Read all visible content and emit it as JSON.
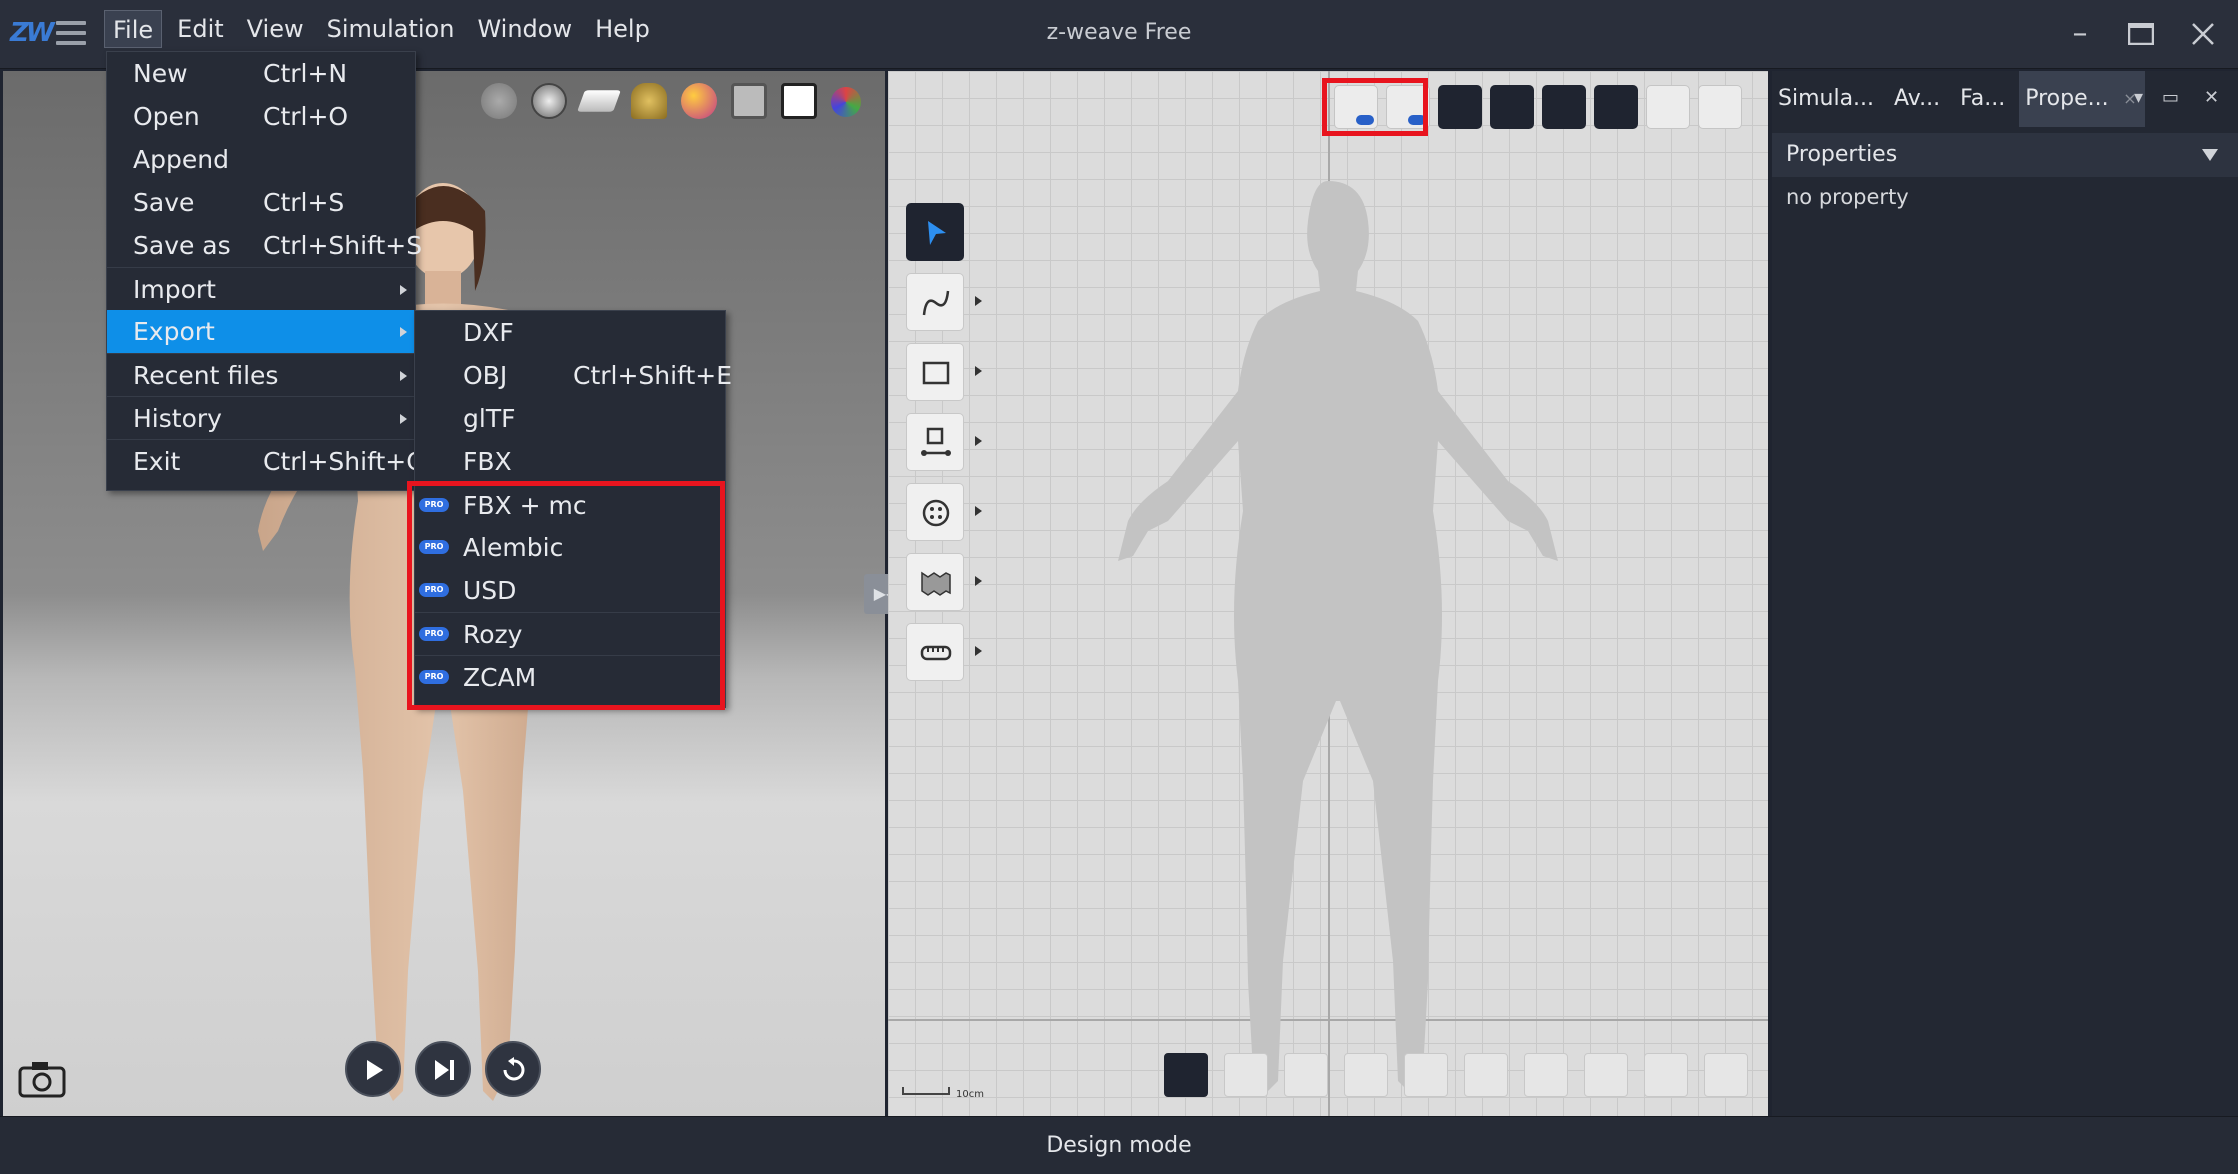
{
  "app": {
    "logo": "ZW",
    "title": "z-weave Free",
    "menubar": [
      "File",
      "Edit",
      "View",
      "Simulation",
      "Window",
      "Help"
    ],
    "window_controls": [
      "minimize-icon",
      "maximize-icon",
      "close-icon"
    ]
  },
  "file_menu": [
    {
      "label": "New",
      "shortcut": "Ctrl+N"
    },
    {
      "label": "Open",
      "shortcut": "Ctrl+O"
    },
    {
      "label": "Append",
      "shortcut": ""
    },
    {
      "label": "Save",
      "shortcut": "Ctrl+S"
    },
    {
      "label": "Save as",
      "shortcut": "Ctrl+Shift+S"
    },
    {
      "label": "Import",
      "shortcut": "",
      "submenu": true
    },
    {
      "label": "Export",
      "shortcut": "",
      "submenu": true,
      "highlighted": true
    },
    {
      "label": "Recent files",
      "shortcut": "",
      "submenu": true
    },
    {
      "label": "History",
      "shortcut": "",
      "submenu": true
    },
    {
      "label": "Exit",
      "shortcut": "Ctrl+Shift+C"
    }
  ],
  "export_menu": [
    {
      "label": "DXF",
      "shortcut": "",
      "pro": false
    },
    {
      "label": "OBJ",
      "shortcut": "Ctrl+Shift+E",
      "pro": false
    },
    {
      "label": "glTF",
      "shortcut": "",
      "pro": false
    },
    {
      "label": "FBX",
      "shortcut": "",
      "pro": false
    },
    {
      "label": "FBX + mc",
      "shortcut": "",
      "pro": true
    },
    {
      "label": "Alembic",
      "shortcut": "",
      "pro": true
    },
    {
      "label": "USD",
      "shortcut": "",
      "pro": true
    },
    {
      "label": "Rozy",
      "shortcut": "",
      "pro": true
    },
    {
      "label": "ZCAM",
      "shortcut": "",
      "pro": true
    }
  ],
  "pro_badge": "PRO",
  "viewport3d": {
    "top_icons": [
      "avatar-mesh-icon",
      "fabric-ball-icon",
      "layer-icon",
      "pose-icon",
      "material-sphere-icon",
      "transparency-icon",
      "sewing-machine-icon",
      "gizmo-icon"
    ],
    "playback": [
      "play-icon",
      "step-forward-icon",
      "reset-icon"
    ]
  },
  "view2d": {
    "top_tools": [
      "avatar-pro-icon",
      "pattern-pro-icon",
      "grid-visibility-icon",
      "snap-visibility-icon",
      "point-visibility-icon",
      "seam-visibility-icon",
      "fabric-visibility-icon",
      "ruler-visibility-icon"
    ],
    "left_tools": [
      "select-tool",
      "curve-tool",
      "rectangle-tool",
      "sewing-tool",
      "button-tool",
      "fold-tool",
      "measure-tool"
    ],
    "bottom_tools": [
      "select-pattern-tool",
      "select-rect-tool",
      "select-curve-tool",
      "select-point-tool",
      "transform-tool",
      "pin-tool",
      "lock-tool",
      "line-tool",
      "add-point-tool",
      "target-tool"
    ],
    "scale_label": "10cm"
  },
  "right_panel": {
    "tabs": [
      "Simula...",
      "Av...",
      "Fa...",
      "Prope..."
    ],
    "active_tab": 3,
    "section_title": "Properties",
    "empty_text": "no property"
  },
  "status": {
    "mode": "Design mode"
  },
  "colors": {
    "highlight": "#0e8fe8",
    "pro_badge": "#2f6ee0",
    "annotation_red": "#e8141e"
  }
}
